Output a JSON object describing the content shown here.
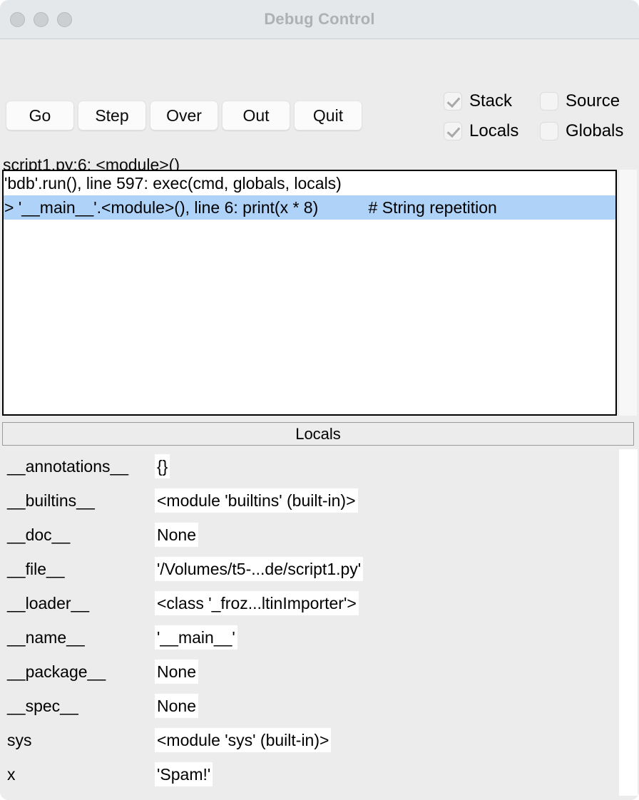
{
  "window": {
    "title": "Debug Control",
    "traffic_lights": [
      "close",
      "minimize",
      "zoom"
    ]
  },
  "toolbar": {
    "buttons": [
      {
        "label": "Go",
        "name": "go-button"
      },
      {
        "label": "Step",
        "name": "step-button"
      },
      {
        "label": "Over",
        "name": "over-button"
      },
      {
        "label": "Out",
        "name": "out-button"
      },
      {
        "label": "Quit",
        "name": "quit-button"
      }
    ],
    "checkboxes": [
      {
        "label": "Stack",
        "checked": true
      },
      {
        "label": "Source",
        "checked": false
      },
      {
        "label": "Locals",
        "checked": true
      },
      {
        "label": "Globals",
        "checked": false
      }
    ]
  },
  "status": {
    "text": "script1.py:6: <module>()"
  },
  "stack": {
    "lines": [
      {
        "text": "'bdb'.run(), line 597: exec(cmd, globals, locals)",
        "selected": false
      },
      {
        "text": "> '__main__'.<module>(), line 6: print(x * 8)           # String repetition",
        "selected": true
      }
    ]
  },
  "locals": {
    "header": "Locals",
    "rows": [
      {
        "name": "__annotations__",
        "value": "{}"
      },
      {
        "name": "__builtins__",
        "value": "<module 'builtins' (built-in)>"
      },
      {
        "name": "__doc__",
        "value": "None"
      },
      {
        "name": "__file__",
        "value": "'/Volumes/t5-...de/script1.py'"
      },
      {
        "name": "__loader__",
        "value": "<class '_froz...ltinImporter'>"
      },
      {
        "name": "__name__",
        "value": "'__main__'"
      },
      {
        "name": "__package__",
        "value": "None"
      },
      {
        "name": "__spec__",
        "value": "None"
      },
      {
        "name": "sys",
        "value": "<module 'sys' (built-in)>"
      },
      {
        "name": "x",
        "value": "'Spam!'"
      }
    ]
  },
  "colors": {
    "selection": "#aed2f8",
    "titlebar": "#e4e8ea",
    "panel": "#ececec"
  }
}
